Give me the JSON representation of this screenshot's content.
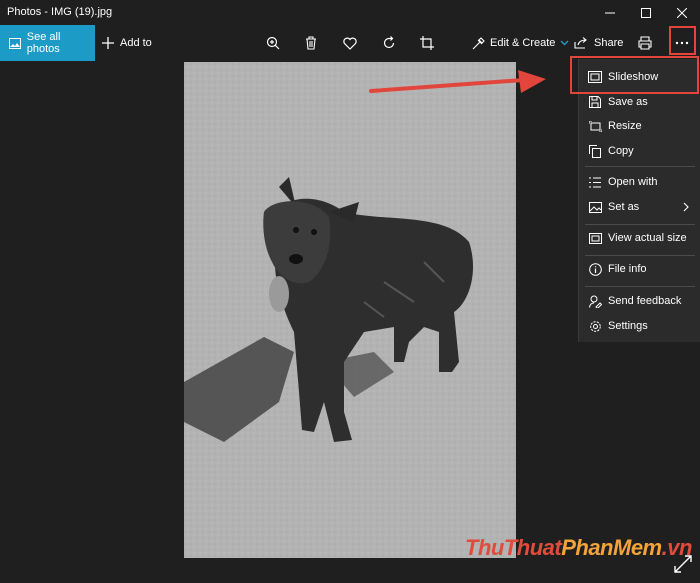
{
  "window": {
    "title": "Photos - IMG (19).jpg"
  },
  "toolbar": {
    "see_all_photos": "See all photos",
    "add_to": "Add to",
    "edit_create": "Edit & Create",
    "share": "Share"
  },
  "menu": {
    "items": [
      {
        "label": "Slideshow",
        "icon": "slideshow-icon"
      },
      {
        "label": "Save as",
        "icon": "save-icon"
      },
      {
        "label": "Resize",
        "icon": "resize-icon"
      },
      {
        "label": "Copy",
        "icon": "copy-icon"
      },
      {
        "label": "Open with",
        "icon": "open-with-icon"
      },
      {
        "label": "Set as",
        "icon": "set-as-icon"
      },
      {
        "label": "View actual size",
        "icon": "actual-size-icon"
      },
      {
        "label": "File info",
        "icon": "info-icon"
      },
      {
        "label": "Send feedback",
        "icon": "feedback-icon"
      },
      {
        "label": "Settings",
        "icon": "gear-icon"
      }
    ]
  },
  "watermark": {
    "part1": "ThuThuat",
    "part2": "PhanMem",
    "part3": ".vn"
  },
  "colors": {
    "accent": "#1c9bc7",
    "highlight": "#e2453c",
    "background": "#1f1f1f",
    "menu": "#2b2b2b"
  }
}
